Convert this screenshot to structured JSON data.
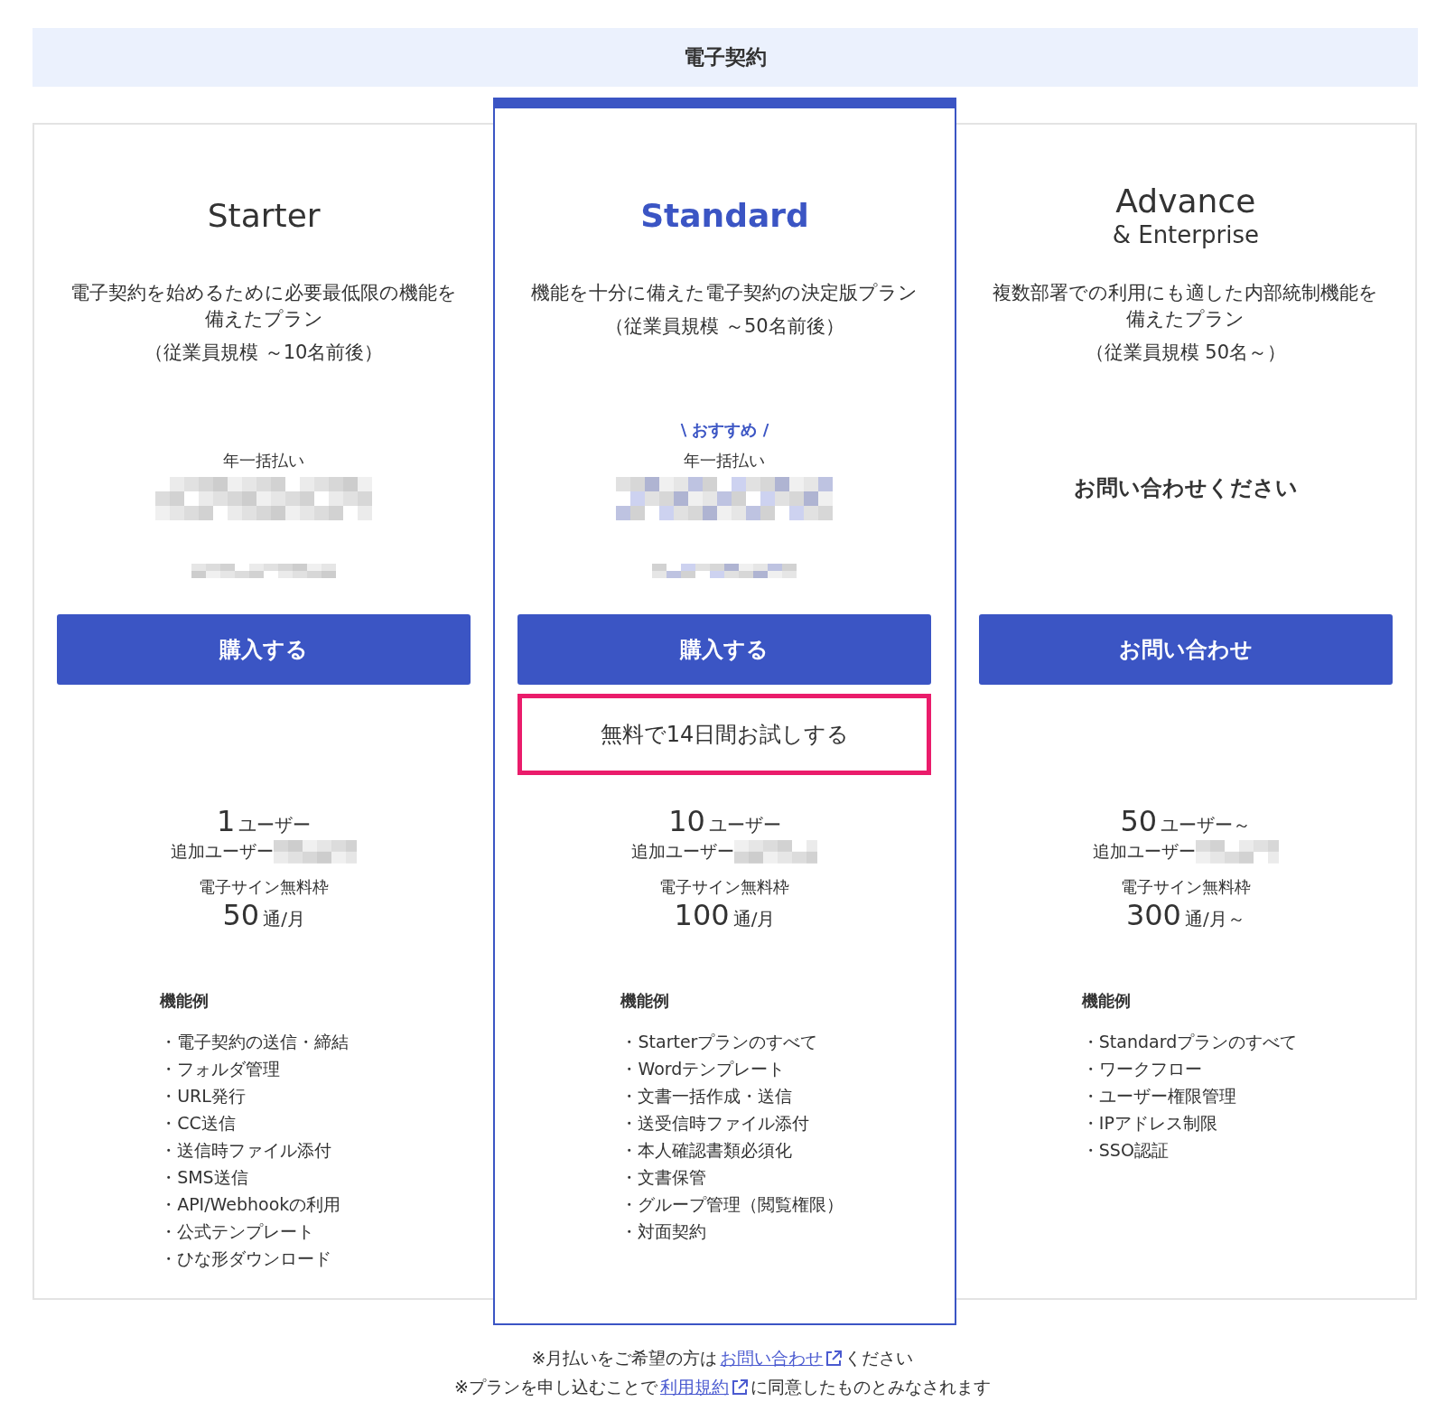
{
  "header": {
    "title": "電子契約"
  },
  "plans": [
    {
      "name": "Starter",
      "featured": false,
      "description": "電子契約を始めるために必要最低限の機能を備えたプラン",
      "employees": "（従業員規模 ～10名前後）",
      "price": {
        "kind": "blurred",
        "label": "年一括払い"
      },
      "buttons": [
        {
          "kind": "primary",
          "label": "購入する"
        }
      ],
      "users": "1",
      "users_unit": "ユーザー",
      "extra_user": "追加ユーザー",
      "sign_label": "電子サイン無料枠",
      "sign_count": "50",
      "sign_unit": "通/月",
      "features_heading": "機能例",
      "features": [
        "・電子契約の送信・締結",
        "・フォルダ管理",
        "・URL発行",
        "・CC送信",
        "・送信時ファイル添付",
        "・SMS送信",
        "・API/Webhookの利用",
        "・公式テンプレート",
        "・ひな形ダウンロード"
      ]
    },
    {
      "name": "Standard",
      "featured": true,
      "description": "機能を十分に備えた電子契約の決定版プラン",
      "employees": "（従業員規模 ～50名前後）",
      "badge": "\\ おすすめ /",
      "price": {
        "kind": "blurred",
        "label": "年一括払い"
      },
      "buttons": [
        {
          "kind": "primary",
          "label": "購入する"
        },
        {
          "kind": "trial",
          "label": "無料で14日間お試しする"
        }
      ],
      "users": "10",
      "users_unit": "ユーザー",
      "extra_user": "追加ユーザー",
      "sign_label": "電子サイン無料枠",
      "sign_count": "100",
      "sign_unit": "通/月",
      "features_heading": "機能例",
      "features": [
        "・Starterプランのすべて",
        "・Wordテンプレート",
        "・文書一括作成・送信",
        "・送受信時ファイル添付",
        "・本人確認書類必須化",
        "・文書保管",
        "・グループ管理（閲覧権限）",
        "・対面契約"
      ]
    },
    {
      "name": "Advance",
      "subtitle": "& Enterprise",
      "featured": false,
      "description": "複数部署での利用にも適した内部統制機能を備えたプラン",
      "employees": "（従業員規模 50名～）",
      "price": {
        "kind": "contact",
        "label": "お問い合わせください"
      },
      "buttons": [
        {
          "kind": "primary",
          "label": "お問い合わせ"
        }
      ],
      "users": "50",
      "users_unit": "ユーザー～",
      "extra_user": "追加ユーザー",
      "sign_label": "電子サイン無料枠",
      "sign_count": "300",
      "sign_unit": "通/月～",
      "features_heading": "機能例",
      "features": [
        "・Standardプランのすべて",
        "・ワークフロー",
        "・ユーザー権限管理",
        "・IPアドレス制限",
        "・SSO認証"
      ]
    }
  ],
  "notes": [
    {
      "before": "※月払いをご希望の方は",
      "link": "お問い合わせ",
      "after": "ください"
    },
    {
      "before": "※プランを申し込むことで ",
      "link": "利用規約",
      "after": " に同意したものとみなされます"
    }
  ]
}
